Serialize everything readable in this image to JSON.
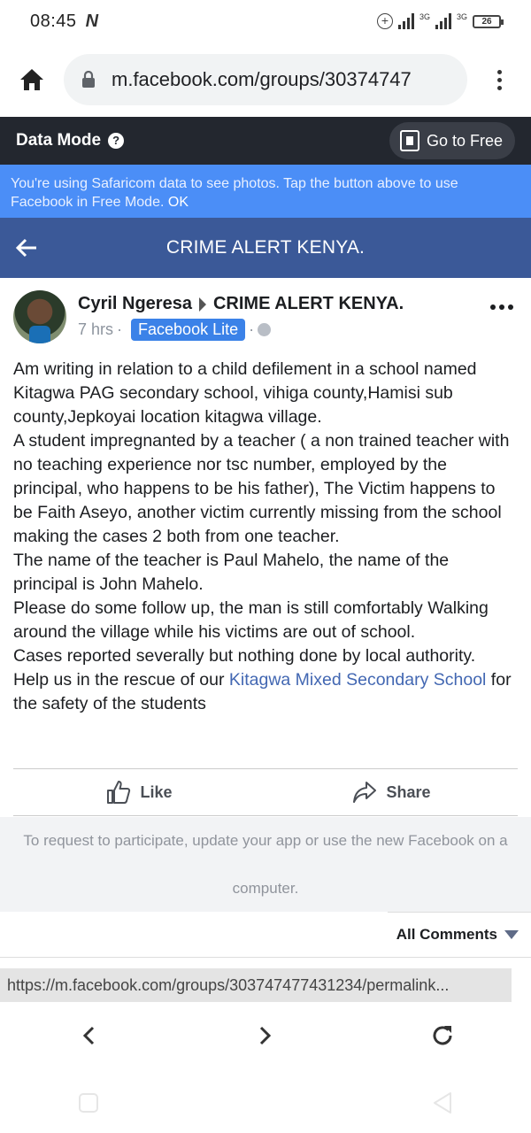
{
  "status_bar": {
    "time": "08:45",
    "network_1": "3G",
    "network_2": "3G",
    "battery": "26"
  },
  "browser": {
    "url": "m.facebook.com/groups/30374747"
  },
  "data_mode": {
    "label": "Data Mode",
    "go_free": "Go to Free"
  },
  "notice": {
    "text": "You're using Safaricom data to see photos. Tap the button above to use Facebook in Free Mode.",
    "ok": "OK"
  },
  "group": {
    "title": "CRIME ALERT KENYA."
  },
  "post": {
    "author": "Cyril Ngeresa",
    "target": "CRIME ALERT KENYA.",
    "time": "7 hrs",
    "dot": "·",
    "app_badge": "Facebook Lite",
    "paragraphs": [
      "Am writing in relation to a child defilement in a school named Kitagwa PAG secondary school, vihiga county,Hamisi sub county,Jepkoyai location kitagwa village.",
      "A student impregnanted by a teacher ( a non trained teacher with no teaching experience nor tsc number, employed by the principal, who happens to be his father), The Victim happens to be Faith Aseyo, another victim currently missing from the school making the cases 2 both from one teacher.",
      "The name of the teacher is Paul Mahelo, the name of the principal is John Mahelo.",
      "Please do some follow up, the man is still comfortably Walking around the village while his victims are out of school.",
      "Cases reported severally but nothing done by local authority."
    ],
    "last_prefix": "Help us in the rescue of our ",
    "last_link": "Kitagwa Mixed Secondary School",
    "last_suffix": " for the safety of the students"
  },
  "actions": {
    "like": "Like",
    "share": "Share"
  },
  "participate": {
    "line1": "To request to participate, update your app or use the new Facebook on a",
    "line2": "computer."
  },
  "comments": {
    "label": "All Comments"
  },
  "url_preview": "https://m.facebook.com/groups/303747477431234/permalink..."
}
